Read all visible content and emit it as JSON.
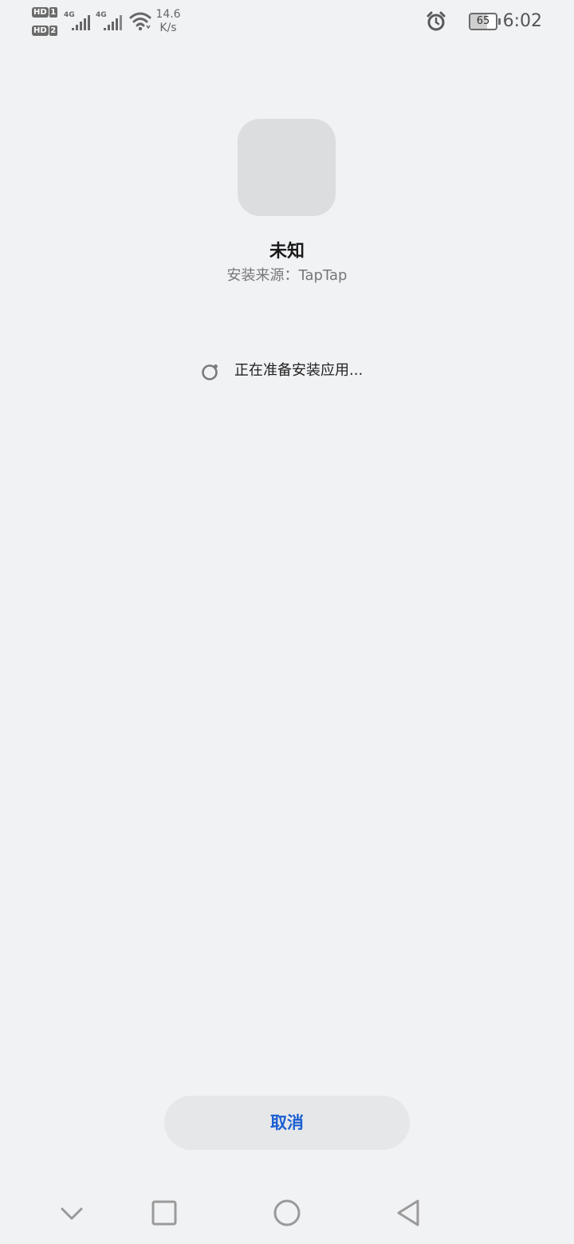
{
  "status_bar": {
    "sim1_label": "HD",
    "sim1_num": "1",
    "sim2_label": "HD",
    "sim2_num": "2",
    "network1": "4G",
    "network2": "4G",
    "speed_value": "14.6",
    "speed_unit": "K/s",
    "battery_level": "65",
    "time": "6:02"
  },
  "app": {
    "name": "未知",
    "source_label": "安装来源：",
    "source_value": "TapTap"
  },
  "progress": {
    "text": "正在准备安装应用..."
  },
  "actions": {
    "cancel_label": "取消"
  },
  "colors": {
    "background": "#f1f2f4",
    "accent": "#1a5fd3",
    "icon_placeholder": "#dcdddf"
  },
  "icons": {
    "nav_down": "chevron-down-icon",
    "nav_recent": "square-icon",
    "nav_home": "circle-icon",
    "nav_back": "triangle-back-icon",
    "alarm": "alarm-clock-icon",
    "wifi": "wifi-icon"
  }
}
